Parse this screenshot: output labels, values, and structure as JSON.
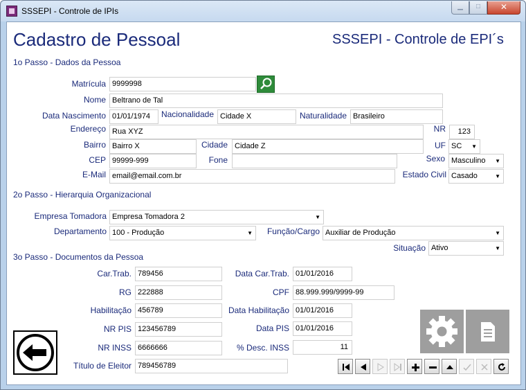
{
  "window": {
    "title": "SSSEPI - Controle de IPIs"
  },
  "header": {
    "title": "Cadastro de Pessoal",
    "app_title": "SSSEPI - Controle de EPI´s"
  },
  "section1": {
    "title": "1o Passo - Dados da Pessoa",
    "matricula": {
      "label": "Matrícula",
      "value": "9999998"
    },
    "nome": {
      "label": "Nome",
      "value": "Beltrano de Tal"
    },
    "data_nascimento": {
      "label": "Data Nascimento",
      "value": "01/01/1974"
    },
    "nacionalidade": {
      "label": "Nacionalidade",
      "value": "Cidade X"
    },
    "naturalidade": {
      "label": "Naturalidade",
      "value": "Brasileiro"
    },
    "endereco": {
      "label": "Endereço",
      "value": "Rua XYZ"
    },
    "nr": {
      "label": "NR",
      "value": "123"
    },
    "bairro": {
      "label": "Bairro",
      "value": "Bairro X"
    },
    "cidade": {
      "label": "Cidade",
      "value": "Cidade Z"
    },
    "uf": {
      "label": "UF",
      "value": "SC"
    },
    "cep": {
      "label": "CEP",
      "value": "99999-999"
    },
    "fone": {
      "label": "Fone",
      "value": ""
    },
    "sexo": {
      "label": "Sexo",
      "value": "Masculino"
    },
    "email": {
      "label": "E-Mail",
      "value": "email@email.com.br"
    },
    "estado_civil": {
      "label": "Estado Civil",
      "value": "Casado"
    }
  },
  "section2": {
    "title": "2o Passo - Hierarquia Organizacional",
    "empresa": {
      "label": "Empresa Tomadora",
      "value": "Empresa Tomadora 2"
    },
    "departamento": {
      "label": "Departamento",
      "value": "100 - Produção"
    },
    "funcao": {
      "label": "Função/Cargo",
      "value": "Auxiliar de Produção"
    },
    "situacao": {
      "label": "Situação",
      "value": "Ativo"
    }
  },
  "section3": {
    "title": "3o Passo - Documentos da Pessoa",
    "car_trab": {
      "label": "Car.Trab.",
      "value": "789456"
    },
    "data_car_trab": {
      "label": "Data Car.Trab.",
      "value": "01/01/2016"
    },
    "rg": {
      "label": "RG",
      "value": "222888"
    },
    "cpf": {
      "label": "CPF",
      "value": "88.999.999/9999-99"
    },
    "habilitacao": {
      "label": "Habilitação",
      "value": "456789"
    },
    "data_habilitacao": {
      "label": "Data Habilitação",
      "value": "01/01/2016"
    },
    "nr_pis": {
      "label": "NR PIS",
      "value": "123456789"
    },
    "data_pis": {
      "label": "Data PIS",
      "value": "01/01/2016"
    },
    "nr_inss": {
      "label": "NR INSS",
      "value": "6666666"
    },
    "desc_inss": {
      "label": "% Desc. INSS",
      "value": "11"
    },
    "titulo_eleitor": {
      "label": "Título de Eleitor",
      "value": "789456789"
    }
  },
  "icons": {
    "search": "magnifier-icon",
    "settings": "gear-icon",
    "report": "document-icon",
    "back": "arrow-left-icon",
    "nav": [
      "first-record-icon",
      "previous-record-icon",
      "next-record-icon",
      "last-record-icon",
      "add-record-icon",
      "delete-record-icon",
      "up-icon",
      "save-icon",
      "cancel-icon",
      "refresh-icon"
    ]
  },
  "colors": {
    "accent": "#1a2a7a",
    "search_button": "#2e8b3a",
    "tile": "#9e9e9e"
  }
}
